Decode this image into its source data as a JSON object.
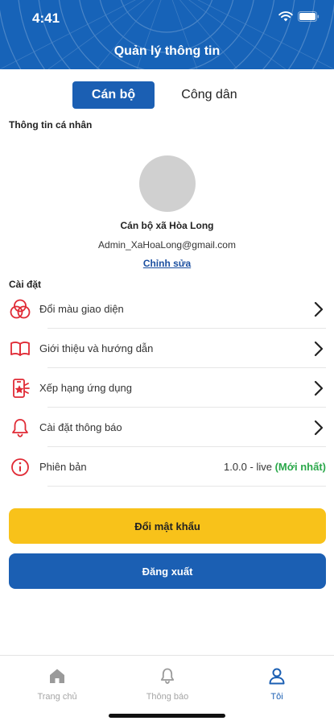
{
  "status_bar": {
    "time": "4:41"
  },
  "header": {
    "title": "Quản lý thông tin"
  },
  "tabs": [
    {
      "label": "Cán bộ",
      "active": true
    },
    {
      "label": "Công dân",
      "active": false
    }
  ],
  "profile": {
    "section_title": "Thông tin cá nhân",
    "name": "Cán bộ xã Hòa Long",
    "email": "Admin_XaHoaLong@gmail.com",
    "edit_label": "Chỉnh sửa"
  },
  "settings": {
    "section_title": "Cài đặt",
    "items": [
      {
        "label": "Đổi màu giao diện",
        "icon": "color-palette-icon"
      },
      {
        "label": "Giới thiệu và hướng dẫn",
        "icon": "book-icon"
      },
      {
        "label": "Xếp hạng ứng dụng",
        "icon": "rating-phone-icon"
      },
      {
        "label": "Cài đặt thông báo",
        "icon": "bell-icon"
      }
    ],
    "version": {
      "label": "Phiên bản",
      "value": "1.0.0 - live",
      "tag": "(Mới nhất)",
      "icon": "info-icon"
    }
  },
  "buttons": {
    "change_password": "Đổi mật khẩu",
    "logout": "Đăng xuất"
  },
  "bottom_nav": [
    {
      "label": "Trang chủ",
      "icon": "home-icon",
      "active": false
    },
    {
      "label": "Thông báo",
      "icon": "bell-icon",
      "active": false
    },
    {
      "label": "Tôi",
      "icon": "user-icon",
      "active": true
    }
  ],
  "colors": {
    "primary": "#1b5fb3",
    "accent_yellow": "#f8c21a",
    "icon_red": "#e02a35",
    "success_green": "#2aa84a"
  }
}
